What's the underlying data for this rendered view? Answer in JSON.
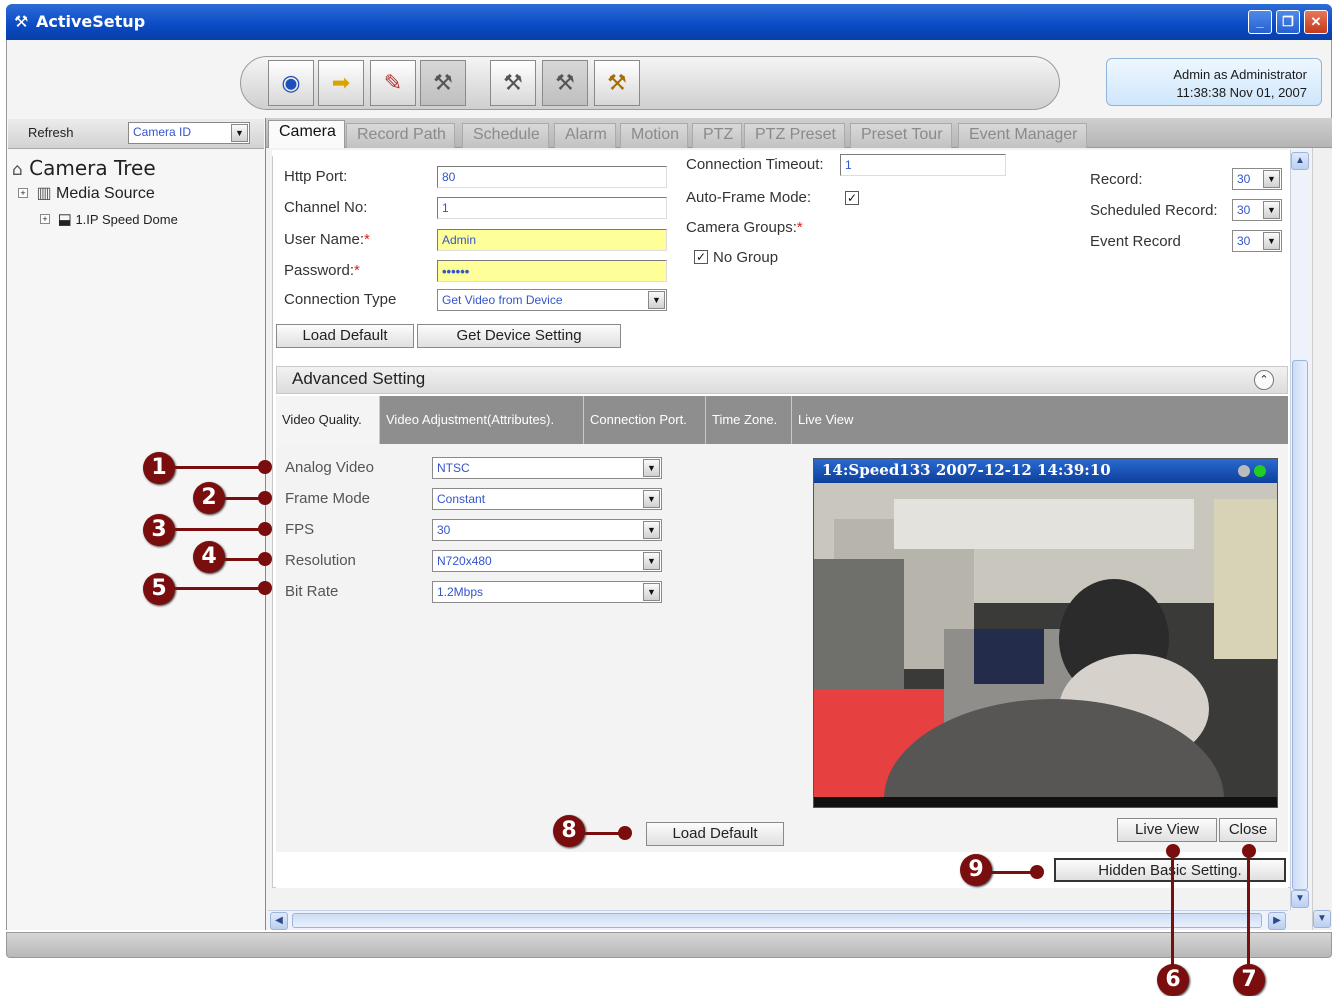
{
  "window": {
    "title": "ActiveSetup",
    "min": "_",
    "max": "❐",
    "close": "✕"
  },
  "user": {
    "line1": "Admin as Administrator",
    "line2": "11:38:38 Nov 01, 2007"
  },
  "toolbar": {
    "group1": [
      "view-icon",
      "camera-setup-icon",
      "path-icon",
      "tools-icon"
    ],
    "group2": [
      "tools-icon",
      "tools-icon",
      "tools-icon"
    ]
  },
  "left": {
    "refresh_label": "Refresh",
    "select_value": "Camera ID",
    "tree_root": "Camera Tree",
    "media_source": "Media Source",
    "camera_node": "1.IP Speed Dome"
  },
  "tabs": [
    "Camera",
    "Record Path",
    "Schedule",
    "Alarm",
    "Motion",
    "PTZ",
    "PTZ Preset",
    "Preset Tour",
    "Event Manager"
  ],
  "basic": {
    "http_port_label": "Http Port:",
    "http_port_value": "80",
    "channel_label": "Channel No:",
    "channel_value": "1",
    "user_label": "User Name:",
    "user_value": "Admin",
    "password_label": "Password:",
    "password_value": "••••••",
    "conn_type_label": "Connection Type",
    "conn_type_value": "Get Video from Device",
    "req_mark": "*",
    "timeout_label": "Connection Timeout:",
    "timeout_value": "1",
    "autoframe_label": "Auto-Frame Mode:",
    "autoframe_checked": "✓",
    "groups_label": "Camera Groups:",
    "nogroup_label": "No Group",
    "nogroup_checked": "✓",
    "record_label": "Record:",
    "record_value": "30",
    "sched_label": "Scheduled Record:",
    "sched_value": "30",
    "event_label": "Event Record",
    "event_value": "30",
    "load_default": "Load Default",
    "get_device": "Get Device Setting"
  },
  "advanced": {
    "title": "Advanced Setting",
    "subtabs": [
      "Video Quality.",
      "Video Adjustment(Attributes).",
      "Connection Port.",
      "Time Zone.",
      "Live View"
    ],
    "rows": [
      {
        "label": "Analog Video",
        "value": "NTSC"
      },
      {
        "label": "Frame Mode",
        "value": "Constant"
      },
      {
        "label": "FPS",
        "value": "30"
      },
      {
        "label": "Resolution",
        "value": "N720x480"
      },
      {
        "label": "Bit Rate",
        "value": "1.2Mbps"
      }
    ],
    "video_caption": "14:Speed133   2007-12-12 14:39:10",
    "load_default": "Load Default",
    "live_view": "Live View",
    "close": "Close",
    "hidden_basic": "Hidden Basic Setting."
  },
  "callouts": [
    "1",
    "2",
    "3",
    "4",
    "5",
    "6",
    "7",
    "8",
    "9"
  ],
  "colors": {
    "title_blue": "#0a4ac4",
    "callout": "#7a0d0d",
    "required": "#e02020",
    "field_yellow": "#ffff99"
  }
}
